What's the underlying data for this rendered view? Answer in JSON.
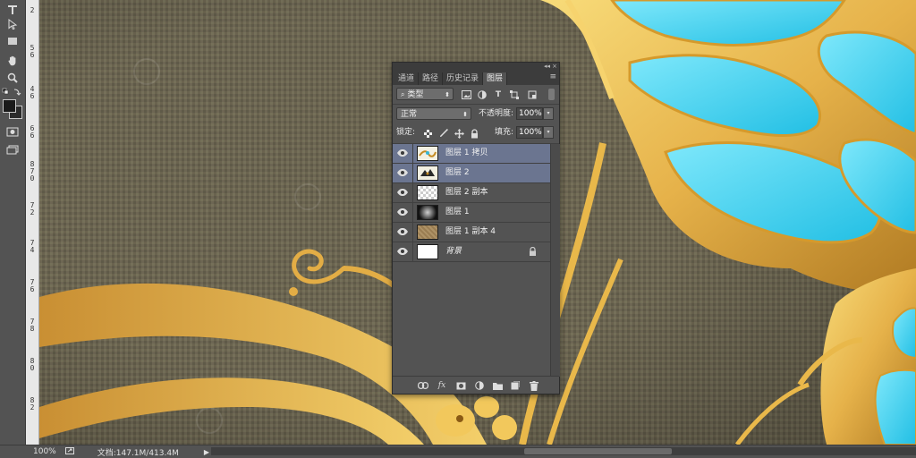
{
  "toolbar": {
    "tools": [
      {
        "name": "type-tool",
        "glyph": "T"
      },
      {
        "name": "path-selection-tool",
        "glyph": "arrow"
      },
      {
        "name": "rectangle-tool",
        "glyph": "rect"
      },
      {
        "name": "hand-tool",
        "glyph": "hand"
      },
      {
        "name": "zoom-tool",
        "glyph": "zoom"
      }
    ],
    "foreground_color": "#1a1a1a",
    "background_color": "#2b2b2b"
  },
  "ruler": {
    "labels": [
      "2",
      "5",
      "6",
      "4",
      "6",
      "6",
      "6",
      "8",
      "7",
      "0",
      "7",
      "2",
      "7",
      "4",
      "7",
      "6",
      "7",
      "8",
      "8",
      "0",
      "8",
      "2"
    ]
  },
  "panel": {
    "tabs": [
      "通道",
      "路径",
      "历史记录",
      "图层"
    ],
    "active_tab": "图层",
    "filter": {
      "label": "类型"
    },
    "blend_mode": "正常",
    "opacity_label": "不透明度:",
    "opacity_value": "100%",
    "lock_label": "锁定:",
    "fill_label": "填充:",
    "fill_value": "100%",
    "layers": [
      {
        "name": "图层 1 拷贝",
        "selected": true,
        "thumb": "gold-ornament"
      },
      {
        "name": "图层 2",
        "selected": true,
        "thumb": "dark-ornament"
      },
      {
        "name": "图层 2 副本",
        "selected": false,
        "thumb": "transparent"
      },
      {
        "name": "图层 1",
        "selected": false,
        "thumb": "glow"
      },
      {
        "name": "图层 1 副本 4",
        "selected": false,
        "thumb": "canvas-texture"
      },
      {
        "name": "背景",
        "selected": false,
        "thumb": "white",
        "locked": true
      }
    ]
  },
  "status": {
    "zoom": "100%",
    "doc_info": "文档:147.1M/413.4M"
  },
  "colors": {
    "accent_selected": "#6b7590",
    "canvas_bg": "#6b6451",
    "gold": "#e9b84a",
    "cyan": "#3fd0ec"
  }
}
